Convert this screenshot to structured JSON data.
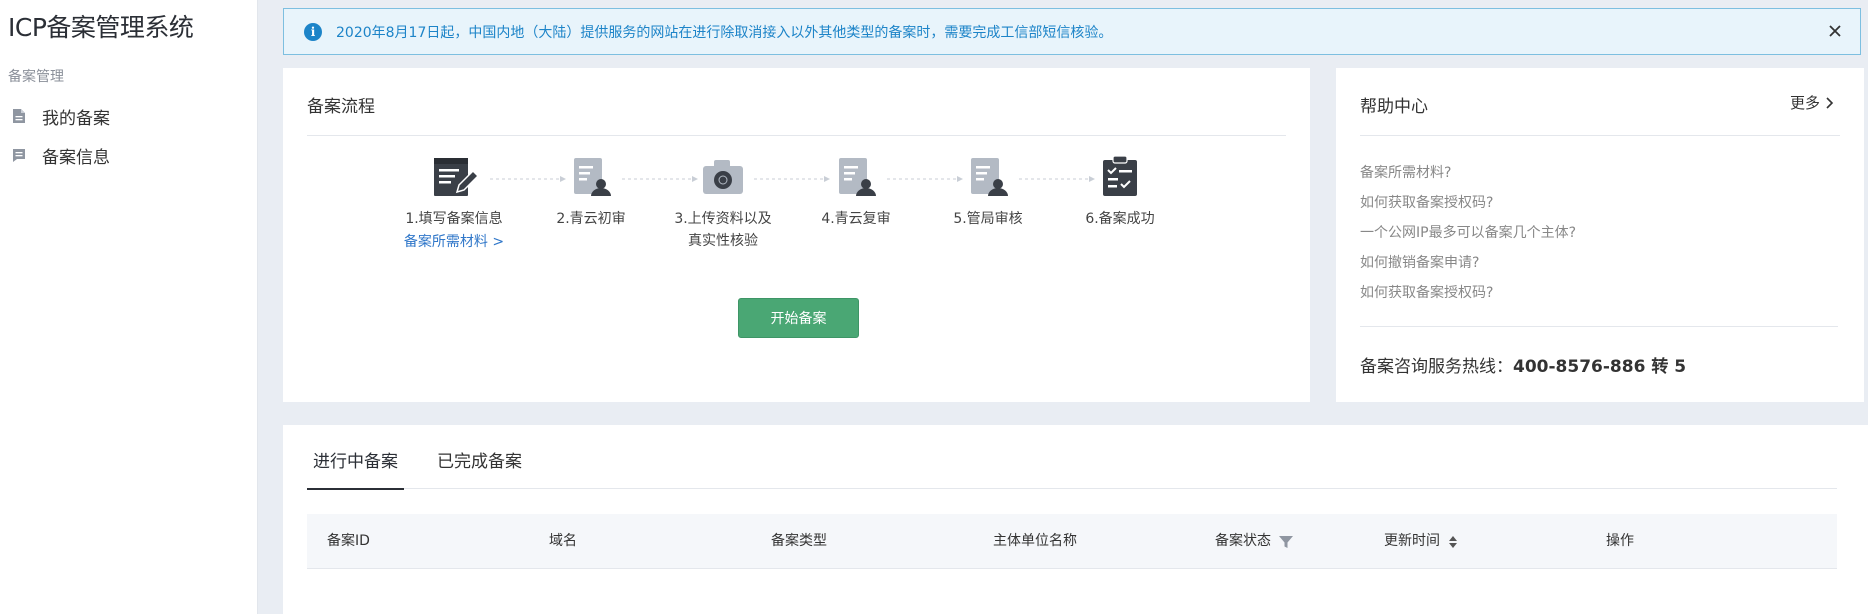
{
  "app": {
    "title": "ICP备案管理系统"
  },
  "sidebar": {
    "group_label": "备案管理",
    "items": [
      {
        "label": "我的备案",
        "icon": "document-icon"
      },
      {
        "label": "备案信息",
        "icon": "info-list-icon"
      }
    ]
  },
  "notice": {
    "text": "2020年8月17日起，中国内地（大陆）提供服务的网站在进行除取消接入以外其他类型的备案时，需要完成工信部短信核验。",
    "icon": "info-icon"
  },
  "flow": {
    "title": "备案流程",
    "steps": [
      {
        "label": "1.填写备案信息",
        "link": "备案所需材料 >",
        "icon": "edit-form-icon"
      },
      {
        "label": "2.青云初审",
        "icon": "user-review-icon"
      },
      {
        "label": "3.上传资料以及",
        "label2": "真实性核验",
        "icon": "camera-icon"
      },
      {
        "label": "4.青云复审",
        "icon": "user-review-icon"
      },
      {
        "label": "5.管局审核",
        "icon": "user-review-icon"
      },
      {
        "label": "6.备案成功",
        "icon": "checklist-icon"
      }
    ],
    "start_button": "开始备案"
  },
  "help": {
    "title": "帮助中心",
    "more": "更多",
    "items": [
      "备案所需材料?",
      "如何获取备案授权码?",
      "一个公网IP最多可以备案几个主体?",
      "如何撤销备案申请?",
      "如何获取备案授权码?"
    ],
    "hotline_label": "备案咨询服务热线：",
    "hotline_number": "400-8576-886 转 5"
  },
  "records": {
    "tabs": [
      {
        "label": "进行中备案",
        "active": true
      },
      {
        "label": "已完成备案",
        "active": false
      }
    ],
    "columns": [
      "备案ID",
      "域名",
      "备案类型",
      "主体单位名称",
      "备案状态",
      "更新时间",
      "操作"
    ]
  },
  "colors": {
    "accent_blue": "#1d84c8",
    "link_blue": "#3077c9",
    "primary_green": "#4aa774",
    "icon_gray": "#b3bac4",
    "icon_dark": "#3a3f47"
  }
}
